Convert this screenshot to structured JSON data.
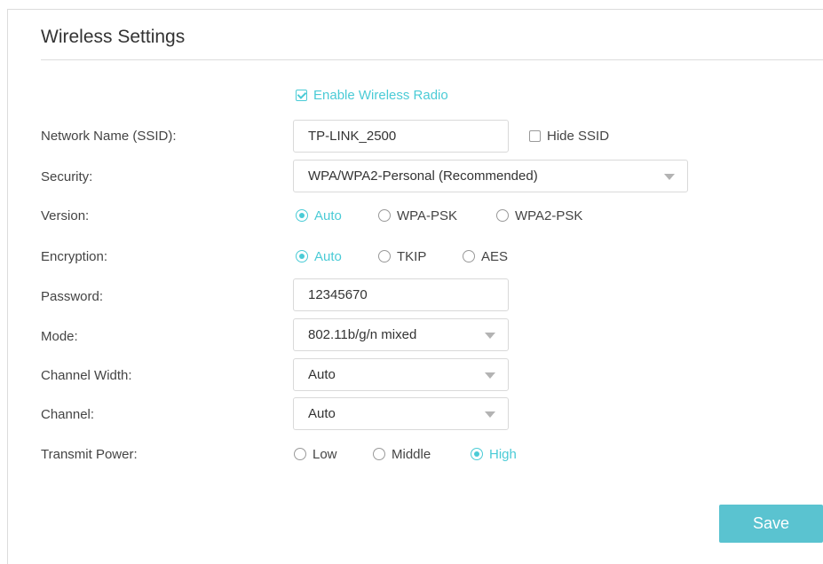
{
  "title": "Wireless Settings",
  "enable_radio": {
    "label": "Enable Wireless Radio",
    "checked": true
  },
  "labels": {
    "ssid": "Network Name (SSID):",
    "security": "Security:",
    "version": "Version:",
    "encryption": "Encryption:",
    "password": "Password:",
    "mode": "Mode:",
    "channel_width": "Channel Width:",
    "channel": "Channel:",
    "transmit_power": "Transmit Power:"
  },
  "ssid": {
    "value": "TP-LINK_2500",
    "hide_label": "Hide SSID",
    "hide_checked": false
  },
  "security": {
    "value": "WPA/WPA2-Personal (Recommended)"
  },
  "version": {
    "options": [
      "Auto",
      "WPA-PSK",
      "WPA2-PSK"
    ],
    "selected": "Auto"
  },
  "encryption": {
    "options": [
      "Auto",
      "TKIP",
      "AES"
    ],
    "selected": "Auto"
  },
  "password": {
    "value": "12345670"
  },
  "mode": {
    "value": "802.11b/g/n mixed"
  },
  "channel_width": {
    "value": "Auto"
  },
  "channel": {
    "value": "Auto"
  },
  "transmit_power": {
    "options": [
      "Low",
      "Middle",
      "High"
    ],
    "selected": "High"
  },
  "save_label": "Save",
  "colors": {
    "accent": "#4acbd6",
    "button": "#5ac3d0",
    "border": "#d9d9d9"
  }
}
